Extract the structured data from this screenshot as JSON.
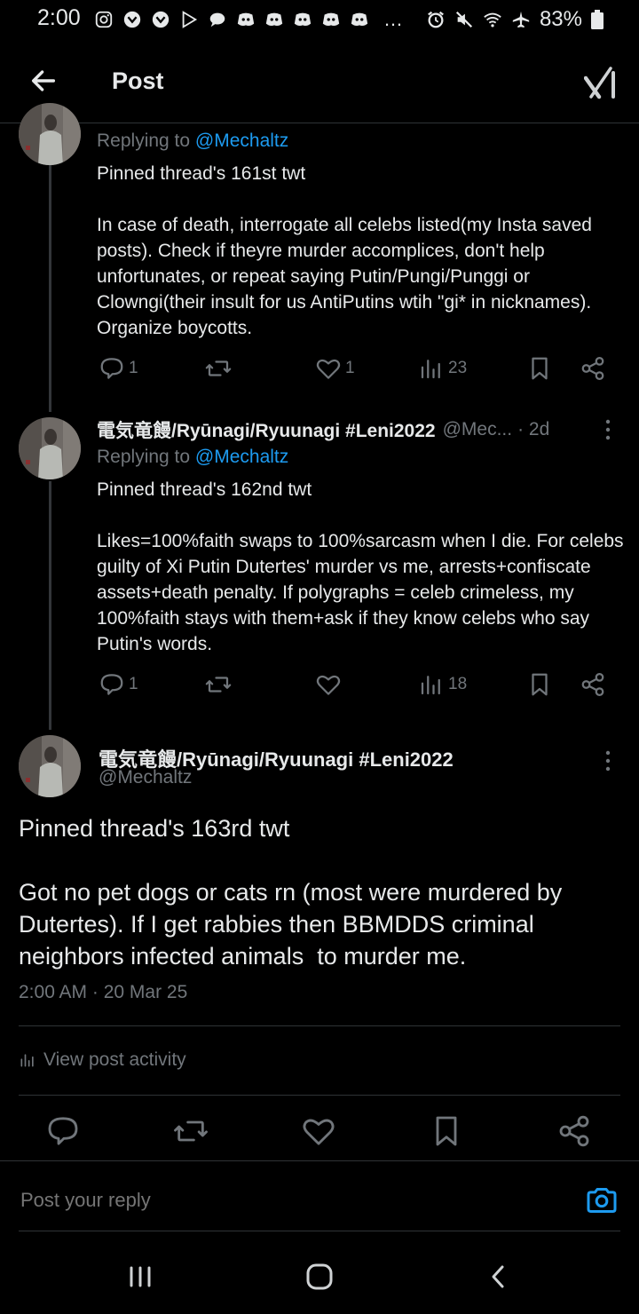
{
  "status_bar": {
    "time": "2:00",
    "more": "…",
    "battery": "83%"
  },
  "header": {
    "title": "Post"
  },
  "tweets": [
    {
      "replying_prefix": "Replying to ",
      "replying_mention": "@Mechaltz",
      "text": "Pinned thread's 161st twt\n\nIn case of death, interrogate all celebs listed(my Insta saved posts). Check if theyre murder accomplices, don't help unfortunates, or repeat saying Putin/Pungi/Punggi or Clowngi(their insult for us AntiPutins wtih \"gi* in nicknames). Organize boycotts.",
      "replies": "1",
      "retweets": "",
      "likes": "1",
      "views": "23"
    },
    {
      "name": "電気竜饅/Ryūnagi/Ryuunagi #Leni2022",
      "handle": "@Mec...",
      "time": "· 2d",
      "replying_prefix": "Replying to ",
      "replying_mention": "@Mechaltz",
      "text": "Pinned thread's 162nd twt\n\nLikes=100%faith swaps to 100%sarcasm when I die. For celebs guilty of Xi Putin Dutertes' murder vs me, arrests+confiscate assets+death penalty. If polygraphs = celeb crimeless, my 100%faith stays with them+ask if they know celebs who say Putin's words.",
      "replies": "1",
      "retweets": "",
      "likes": "",
      "views": "18"
    }
  ],
  "main_post": {
    "name": "電気竜饅/Ryūnagi/Ryuunagi #Leni2022",
    "handle": "@Mechaltz",
    "text": "Pinned thread's 163rd twt\n\nGot no pet dogs or cats rn (most were murdered by Dutertes). If I get rabbies then BBMDDS criminal neighbors infected animals  to murder me.",
    "timestamp": "2:00 AM · 20 Mar 25",
    "activity_label": "View post activity"
  },
  "reply": {
    "placeholder": "Post your reply"
  },
  "colors": {
    "accent": "#1d9bf0",
    "muted": "#71767b",
    "text": "#e7e9ea",
    "background": "#000000"
  }
}
